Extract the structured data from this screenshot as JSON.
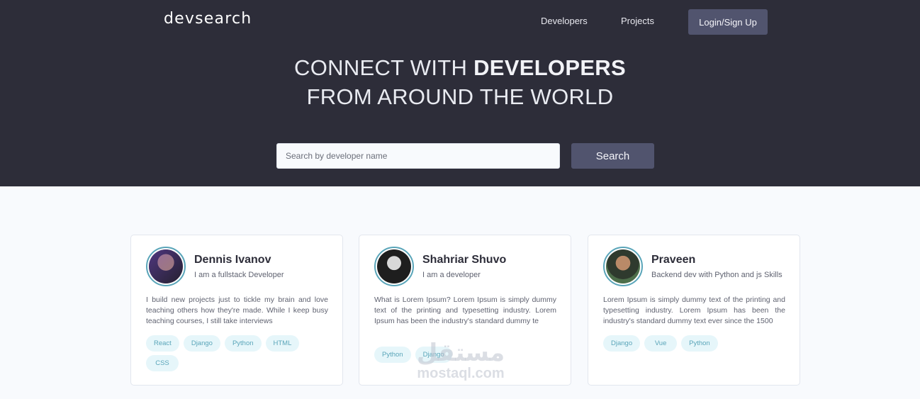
{
  "header": {
    "logo": "devsearch",
    "nav": [
      {
        "label": "Developers"
      },
      {
        "label": "Projects"
      }
    ],
    "login_label": "Login/Sign Up"
  },
  "hero": {
    "line1_prefix": "CONNECT WITH ",
    "line1_bold": "DEVELOPERS",
    "line2": "FROM AROUND THE WORLD"
  },
  "search": {
    "placeholder": "Search by developer name",
    "value": "",
    "button_label": "Search"
  },
  "developers": [
    {
      "name": "Dennis Ivanov",
      "role": "I am a fullstack Developer",
      "bio": "I build new projects just to tickle my brain and love teaching others how they're made. While I keep busy teaching courses, I still take interviews",
      "tags": [
        "React",
        "Django",
        "Python",
        "HTML",
        "CSS"
      ]
    },
    {
      "name": "Shahriar Shuvo",
      "role": "I am a developer",
      "bio": "What is Lorem Ipsum? Lorem Ipsum is simply dummy text of the printing and typesetting industry. Lorem Ipsum has been the industry's standard dummy te",
      "tags": [
        "Python",
        "Django"
      ]
    },
    {
      "name": "Praveen",
      "role": "Backend dev with Python and js Skills",
      "bio": "Lorem Ipsum is simply dummy text of the printing and typesetting industry. Lorem Ipsum has been the industry's standard dummy text ever since the 1500",
      "tags": [
        "Django",
        "Vue",
        "Python"
      ]
    }
  ],
  "watermark": {
    "arabic": "مستقل",
    "latin": "mostaql.com"
  },
  "colors": {
    "hero_bg": "#2d2d39",
    "button_bg": "#51546e",
    "accent": "#5aa5b9",
    "tag_bg": "#e6f6fa",
    "page_bg": "#f8fafd"
  }
}
